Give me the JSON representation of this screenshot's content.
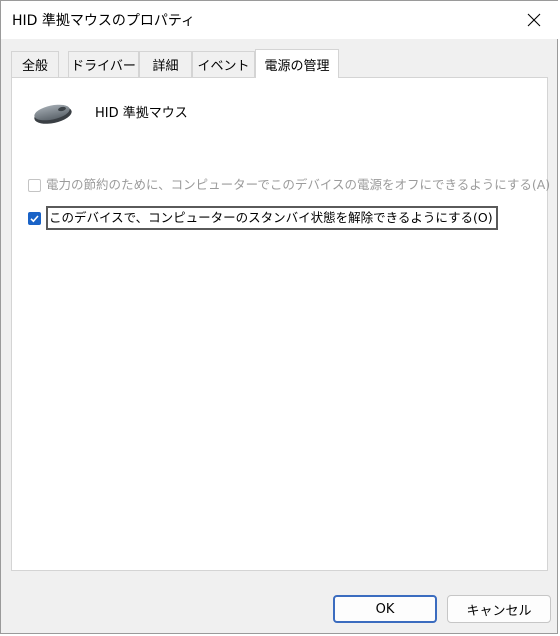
{
  "window": {
    "title": "HID 準拠マウスのプロパティ"
  },
  "tabs": [
    {
      "label": "全般",
      "active": false
    },
    {
      "label": "ドライバー",
      "active": false
    },
    {
      "label": "詳細",
      "active": false
    },
    {
      "label": "イベント",
      "active": false
    },
    {
      "label": "電源の管理",
      "active": true
    }
  ],
  "device": {
    "name": "HID 準拠マウス",
    "icon": "mouse-icon"
  },
  "options": [
    {
      "label": "電力の節約のために、コンピューターでこのデバイスの電源をオフにできるようにする(A)",
      "checked": false,
      "enabled": false
    },
    {
      "label": "このデバイスで、コンピューターのスタンバイ状態を解除できるようにする(O)",
      "checked": true,
      "enabled": true
    }
  ],
  "buttons": {
    "ok": "OK",
    "cancel": "キャンセル"
  },
  "colors": {
    "accent": "#1a63c7",
    "disabled_text": "#9b9b9b"
  }
}
